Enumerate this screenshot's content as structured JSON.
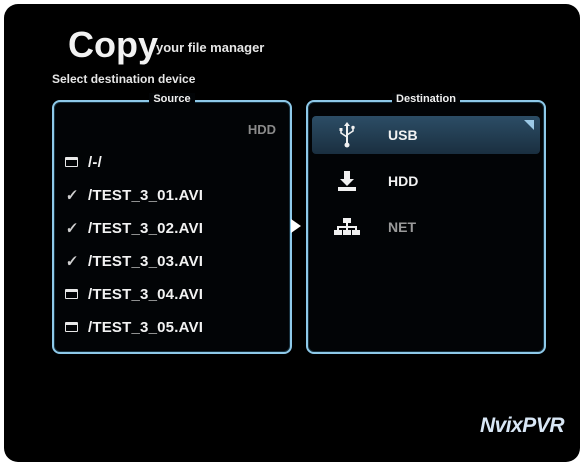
{
  "header": {
    "title": "Copy",
    "subtitle": "your file manager",
    "instruction": "Select destination device"
  },
  "source": {
    "title": "Source",
    "device": "HDD",
    "items": [
      {
        "label": "/-/",
        "icon": "folder-icon"
      },
      {
        "label": "/TEST_3_01.AVI",
        "icon": "check-icon"
      },
      {
        "label": "/TEST_3_02.AVI",
        "icon": "check-icon"
      },
      {
        "label": "/TEST_3_03.AVI",
        "icon": "check-icon"
      },
      {
        "label": "/TEST_3_04.AVI",
        "icon": "folder-icon"
      },
      {
        "label": "/TEST_3_05.AVI",
        "icon": "folder-icon"
      }
    ]
  },
  "destination": {
    "title": "Destination",
    "items": [
      {
        "label": "USB",
        "icon": "usb-icon",
        "selected": true
      },
      {
        "label": "HDD",
        "icon": "download-icon",
        "selected": false
      },
      {
        "label": "NET",
        "icon": "network-icon",
        "selected": false
      }
    ]
  },
  "branding": {
    "logo": "NvixPVR"
  },
  "colors": {
    "accent": "#8ec9e9",
    "selection": "#2c4d66",
    "background": "#000000"
  }
}
